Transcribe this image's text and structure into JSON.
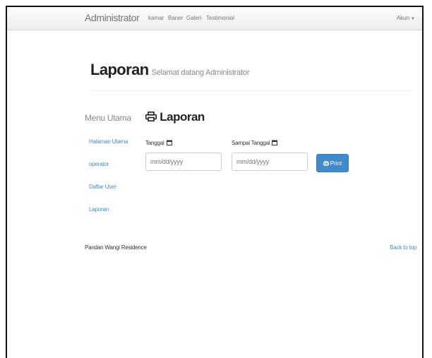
{
  "navbar": {
    "brand": "Administrator",
    "links": [
      "kamar",
      "Baner",
      "Galeri",
      "Testimonial"
    ],
    "account": "Akun"
  },
  "header": {
    "title": "Laporan",
    "subtitle": "Selamat datang Administrator"
  },
  "sidebar": {
    "title": "Menu Utama",
    "items": [
      "Halaman Utama",
      "operator",
      "Daftar User",
      "Laporan"
    ]
  },
  "content": {
    "title": "Laporan",
    "title_icon": "printer-icon",
    "start_label": "Tanggal",
    "end_label": "Sampai Tanggal",
    "label_icon": "calendar-icon",
    "start_value": "mm/dd/yyyy",
    "end_value": "mm/dd/yyyy",
    "print_label": "Print",
    "accent": "#428bca"
  },
  "footer": {
    "left": "Pandan Wangi Residence",
    "right": "Back to top"
  }
}
